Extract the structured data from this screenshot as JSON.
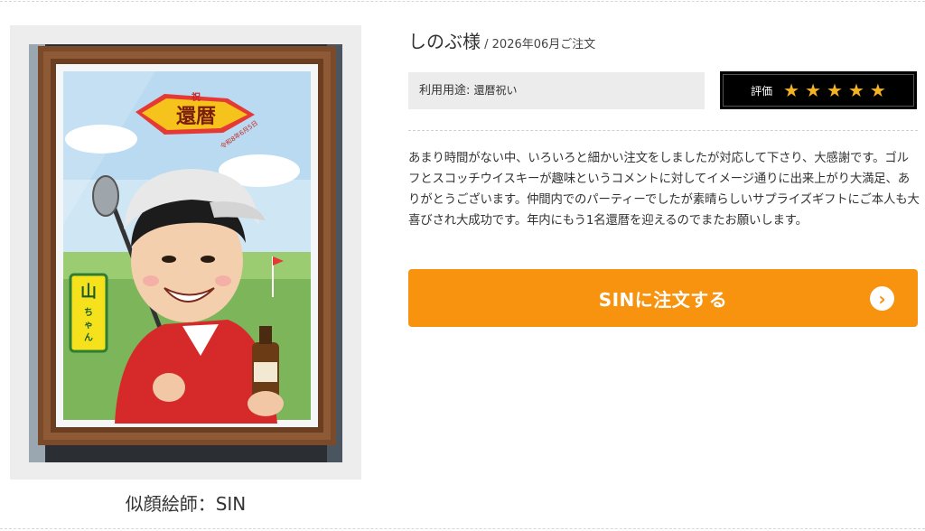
{
  "photo": {
    "banner_text": "還暦",
    "banner_small": "祝",
    "banner_date": "令和8年6月5日",
    "badge_name": "山ちゃん"
  },
  "artist": {
    "caption": "似顔絵師：SIN"
  },
  "customer": {
    "name": "しのぶ様",
    "separator": " / ",
    "order_date": "2026年06月ご注文"
  },
  "usage": {
    "label": "利用用途: ",
    "value": "還暦祝い"
  },
  "rating": {
    "label": "評価",
    "stars": 5,
    "star_glyph": "★",
    "star_color": "#f4b324"
  },
  "review": {
    "text": "あまり時間がない中、いろいろと細かい注文をしましたが対応して下さり、大感謝です。ゴルフとスコッチウイスキーが趣味というコメントに対してイメージ通りに出来上がり大満足、ありがとうございます。仲間内でのパーティーでしたが素晴らしいサプライズギフトにご本人も大喜びされ大成功です。年内にもう1名還暦を迎えるのでまたお願いします。"
  },
  "order_button": {
    "label": "SINに注文する",
    "icon": "chevron-right-icon",
    "color": "#f7930e"
  }
}
